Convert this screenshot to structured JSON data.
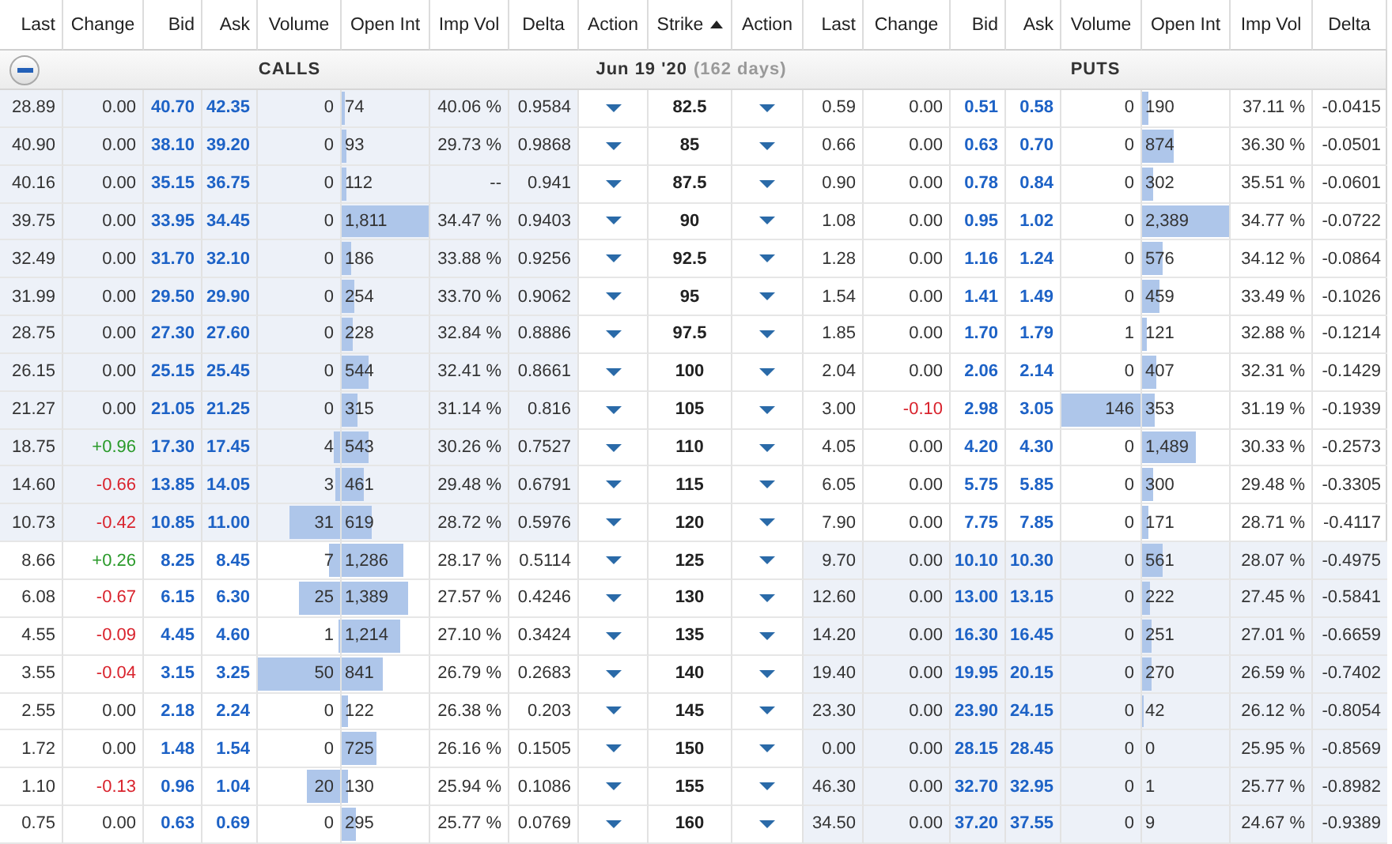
{
  "columns": {
    "calls": [
      "Last",
      "Change",
      "Bid",
      "Ask",
      "Volume",
      "Open Int",
      "Imp Vol",
      "Delta"
    ],
    "left_action": "Action",
    "strike": "Strike",
    "sort_ascending": true,
    "right_action": "Action",
    "puts": [
      "Last",
      "Change",
      "Bid",
      "Ask",
      "Volume",
      "Open Int",
      "Imp Vol",
      "Delta"
    ]
  },
  "section": {
    "expanded": true,
    "calls_label": "CALLS",
    "expiry": "Jun 19 '20",
    "days": "(162 days)",
    "puts_label": "PUTS"
  },
  "rows": [
    {
      "strike": "82.5",
      "call": {
        "last": "28.89",
        "change": {
          "value": "0.00",
          "color": "#333333"
        },
        "bid": "40.70",
        "ask": "42.35",
        "volume": {
          "value": "0",
          "level": 0
        },
        "open_int": {
          "value": "74",
          "level": 0.041
        },
        "imp_vol": "40.06 %",
        "delta": "0.9584",
        "in_the_money": true
      },
      "put": {
        "last": "0.59",
        "change": {
          "value": "0.00",
          "color": "#333333"
        },
        "bid": "0.51",
        "ask": "0.58",
        "volume": {
          "value": "0",
          "level": 0
        },
        "open_int": {
          "value": "190",
          "level": 0.08
        },
        "imp_vol": "37.11 %",
        "delta": "-0.0415",
        "in_the_money": false
      }
    },
    {
      "strike": "85",
      "call": {
        "last": "40.90",
        "change": {
          "value": "0.00",
          "color": "#333333"
        },
        "bid": "38.10",
        "ask": "39.20",
        "volume": {
          "value": "0",
          "level": 0
        },
        "open_int": {
          "value": "93",
          "level": 0.051
        },
        "imp_vol": "29.73 %",
        "delta": "0.9868",
        "in_the_money": true
      },
      "put": {
        "last": "0.66",
        "change": {
          "value": "0.00",
          "color": "#333333"
        },
        "bid": "0.63",
        "ask": "0.70",
        "volume": {
          "value": "0",
          "level": 0
        },
        "open_int": {
          "value": "874",
          "level": 0.366
        },
        "imp_vol": "36.30 %",
        "delta": "-0.0501",
        "in_the_money": false
      }
    },
    {
      "strike": "87.5",
      "call": {
        "last": "40.16",
        "change": {
          "value": "0.00",
          "color": "#333333"
        },
        "bid": "35.15",
        "ask": "36.75",
        "volume": {
          "value": "0",
          "level": 0
        },
        "open_int": {
          "value": "112",
          "level": 0.062
        },
        "imp_vol": "--",
        "delta": "0.941",
        "in_the_money": true
      },
      "put": {
        "last": "0.90",
        "change": {
          "value": "0.00",
          "color": "#333333"
        },
        "bid": "0.78",
        "ask": "0.84",
        "volume": {
          "value": "0",
          "level": 0
        },
        "open_int": {
          "value": "302",
          "level": 0.126
        },
        "imp_vol": "35.51 %",
        "delta": "-0.0601",
        "in_the_money": false
      }
    },
    {
      "strike": "90",
      "call": {
        "last": "39.75",
        "change": {
          "value": "0.00",
          "color": "#333333"
        },
        "bid": "33.95",
        "ask": "34.45",
        "volume": {
          "value": "0",
          "level": 0
        },
        "open_int": {
          "value": "1,811",
          "level": 1
        },
        "imp_vol": "34.47 %",
        "delta": "0.9403",
        "in_the_money": true
      },
      "put": {
        "last": "1.08",
        "change": {
          "value": "0.00",
          "color": "#333333"
        },
        "bid": "0.95",
        "ask": "1.02",
        "volume": {
          "value": "0",
          "level": 0
        },
        "open_int": {
          "value": "2,389",
          "level": 1
        },
        "imp_vol": "34.77 %",
        "delta": "-0.0722",
        "in_the_money": false
      }
    },
    {
      "strike": "92.5",
      "call": {
        "last": "32.49",
        "change": {
          "value": "0.00",
          "color": "#333333"
        },
        "bid": "31.70",
        "ask": "32.10",
        "volume": {
          "value": "0",
          "level": 0
        },
        "open_int": {
          "value": "186",
          "level": 0.103
        },
        "imp_vol": "33.88 %",
        "delta": "0.9256",
        "in_the_money": true
      },
      "put": {
        "last": "1.28",
        "change": {
          "value": "0.00",
          "color": "#333333"
        },
        "bid": "1.16",
        "ask": "1.24",
        "volume": {
          "value": "0",
          "level": 0
        },
        "open_int": {
          "value": "576",
          "level": 0.241
        },
        "imp_vol": "34.12 %",
        "delta": "-0.0864",
        "in_the_money": false
      }
    },
    {
      "strike": "95",
      "call": {
        "last": "31.99",
        "change": {
          "value": "0.00",
          "color": "#333333"
        },
        "bid": "29.50",
        "ask": "29.90",
        "volume": {
          "value": "0",
          "level": 0
        },
        "open_int": {
          "value": "254",
          "level": 0.14
        },
        "imp_vol": "33.70 %",
        "delta": "0.9062",
        "in_the_money": true
      },
      "put": {
        "last": "1.54",
        "change": {
          "value": "0.00",
          "color": "#333333"
        },
        "bid": "1.41",
        "ask": "1.49",
        "volume": {
          "value": "0",
          "level": 0
        },
        "open_int": {
          "value": "459",
          "level": 0.192
        },
        "imp_vol": "33.49 %",
        "delta": "-0.1026",
        "in_the_money": false
      }
    },
    {
      "strike": "97.5",
      "call": {
        "last": "28.75",
        "change": {
          "value": "0.00",
          "color": "#333333"
        },
        "bid": "27.30",
        "ask": "27.60",
        "volume": {
          "value": "0",
          "level": 0
        },
        "open_int": {
          "value": "228",
          "level": 0.126
        },
        "imp_vol": "32.84 %",
        "delta": "0.8886",
        "in_the_money": true
      },
      "put": {
        "last": "1.85",
        "change": {
          "value": "0.00",
          "color": "#333333"
        },
        "bid": "1.70",
        "ask": "1.79",
        "volume": {
          "value": "1",
          "level": 0
        },
        "open_int": {
          "value": "121",
          "level": 0.051
        },
        "imp_vol": "32.88 %",
        "delta": "-0.1214",
        "in_the_money": false
      }
    },
    {
      "strike": "100",
      "call": {
        "last": "26.15",
        "change": {
          "value": "0.00",
          "color": "#333333"
        },
        "bid": "25.15",
        "ask": "25.45",
        "volume": {
          "value": "0",
          "level": 0
        },
        "open_int": {
          "value": "544",
          "level": 0.3
        },
        "imp_vol": "32.41 %",
        "delta": "0.8661",
        "in_the_money": true
      },
      "put": {
        "last": "2.04",
        "change": {
          "value": "0.00",
          "color": "#333333"
        },
        "bid": "2.06",
        "ask": "2.14",
        "volume": {
          "value": "0",
          "level": 0
        },
        "open_int": {
          "value": "407",
          "level": 0.17
        },
        "imp_vol": "32.31 %",
        "delta": "-0.1429",
        "in_the_money": false
      }
    },
    {
      "strike": "105",
      "call": {
        "last": "21.27",
        "change": {
          "value": "0.00",
          "color": "#333333"
        },
        "bid": "21.05",
        "ask": "21.25",
        "volume": {
          "value": "0",
          "level": 0
        },
        "open_int": {
          "value": "315",
          "level": 0.174
        },
        "imp_vol": "31.14 %",
        "delta": "0.816",
        "in_the_money": true
      },
      "put": {
        "last": "3.00",
        "change": {
          "value": "-0.10",
          "color": "#d9232d"
        },
        "bid": "2.98",
        "ask": "3.05",
        "volume": {
          "value": "146",
          "level": 1
        },
        "open_int": {
          "value": "353",
          "level": 0.148
        },
        "imp_vol": "31.19 %",
        "delta": "-0.1939",
        "in_the_money": false
      }
    },
    {
      "strike": "110",
      "call": {
        "last": "18.75",
        "change": {
          "value": "+0.96",
          "color": "#2a9a2a"
        },
        "bid": "17.30",
        "ask": "17.45",
        "volume": {
          "value": "4",
          "level": 0.08
        },
        "open_int": {
          "value": "543",
          "level": 0.3
        },
        "imp_vol": "30.26 %",
        "delta": "0.7527",
        "in_the_money": true
      },
      "put": {
        "last": "4.05",
        "change": {
          "value": "0.00",
          "color": "#333333"
        },
        "bid": "4.20",
        "ask": "4.30",
        "volume": {
          "value": "0",
          "level": 0
        },
        "open_int": {
          "value": "1,489",
          "level": 0.623
        },
        "imp_vol": "30.33 %",
        "delta": "-0.2573",
        "in_the_money": false
      }
    },
    {
      "strike": "115",
      "call": {
        "last": "14.60",
        "change": {
          "value": "-0.66",
          "color": "#d9232d"
        },
        "bid": "13.85",
        "ask": "14.05",
        "volume": {
          "value": "3",
          "level": 0.06
        },
        "open_int": {
          "value": "461",
          "level": 0.255
        },
        "imp_vol": "29.48 %",
        "delta": "0.6791",
        "in_the_money": true
      },
      "put": {
        "last": "6.05",
        "change": {
          "value": "0.00",
          "color": "#333333"
        },
        "bid": "5.75",
        "ask": "5.85",
        "volume": {
          "value": "0",
          "level": 0
        },
        "open_int": {
          "value": "300",
          "level": 0.126
        },
        "imp_vol": "29.48 %",
        "delta": "-0.3305",
        "in_the_money": false
      }
    },
    {
      "strike": "120",
      "call": {
        "last": "10.73",
        "change": {
          "value": "-0.42",
          "color": "#d9232d"
        },
        "bid": "10.85",
        "ask": "11.00",
        "volume": {
          "value": "31",
          "level": 0.62
        },
        "open_int": {
          "value": "619",
          "level": 0.342
        },
        "imp_vol": "28.72 %",
        "delta": "0.5976",
        "in_the_money": true
      },
      "put": {
        "last": "7.90",
        "change": {
          "value": "0.00",
          "color": "#333333"
        },
        "bid": "7.75",
        "ask": "7.85",
        "volume": {
          "value": "0",
          "level": 0
        },
        "open_int": {
          "value": "171",
          "level": 0.072
        },
        "imp_vol": "28.71 %",
        "delta": "-0.4117",
        "in_the_money": false
      }
    },
    {
      "strike": "125",
      "call": {
        "last": "8.66",
        "change": {
          "value": "+0.26",
          "color": "#2a9a2a"
        },
        "bid": "8.25",
        "ask": "8.45",
        "volume": {
          "value": "7",
          "level": 0.14
        },
        "open_int": {
          "value": "1,286",
          "level": 0.71
        },
        "imp_vol": "28.17 %",
        "delta": "0.5114",
        "in_the_money": false
      },
      "put": {
        "last": "9.70",
        "change": {
          "value": "0.00",
          "color": "#333333"
        },
        "bid": "10.10",
        "ask": "10.30",
        "volume": {
          "value": "0",
          "level": 0
        },
        "open_int": {
          "value": "561",
          "level": 0.235
        },
        "imp_vol": "28.07 %",
        "delta": "-0.4975",
        "in_the_money": true
      }
    },
    {
      "strike": "130",
      "call": {
        "last": "6.08",
        "change": {
          "value": "-0.67",
          "color": "#d9232d"
        },
        "bid": "6.15",
        "ask": "6.30",
        "volume": {
          "value": "25",
          "level": 0.5
        },
        "open_int": {
          "value": "1,389",
          "level": 0.767
        },
        "imp_vol": "27.57 %",
        "delta": "0.4246",
        "in_the_money": false
      },
      "put": {
        "last": "12.60",
        "change": {
          "value": "0.00",
          "color": "#333333"
        },
        "bid": "13.00",
        "ask": "13.15",
        "volume": {
          "value": "0",
          "level": 0
        },
        "open_int": {
          "value": "222",
          "level": 0.093
        },
        "imp_vol": "27.45 %",
        "delta": "-0.5841",
        "in_the_money": true
      }
    },
    {
      "strike": "135",
      "call": {
        "last": "4.55",
        "change": {
          "value": "-0.09",
          "color": "#d9232d"
        },
        "bid": "4.45",
        "ask": "4.60",
        "volume": {
          "value": "1",
          "level": 0.02
        },
        "open_int": {
          "value": "1,214",
          "level": 0.67
        },
        "imp_vol": "27.10 %",
        "delta": "0.3424",
        "in_the_money": false
      },
      "put": {
        "last": "14.20",
        "change": {
          "value": "0.00",
          "color": "#333333"
        },
        "bid": "16.30",
        "ask": "16.45",
        "volume": {
          "value": "0",
          "level": 0
        },
        "open_int": {
          "value": "251",
          "level": 0.105
        },
        "imp_vol": "27.01 %",
        "delta": "-0.6659",
        "in_the_money": true
      }
    },
    {
      "strike": "140",
      "call": {
        "last": "3.55",
        "change": {
          "value": "-0.04",
          "color": "#d9232d"
        },
        "bid": "3.15",
        "ask": "3.25",
        "volume": {
          "value": "50",
          "level": 1
        },
        "open_int": {
          "value": "841",
          "level": 0.464
        },
        "imp_vol": "26.79 %",
        "delta": "0.2683",
        "in_the_money": false
      },
      "put": {
        "last": "19.40",
        "change": {
          "value": "0.00",
          "color": "#333333"
        },
        "bid": "19.95",
        "ask": "20.15",
        "volume": {
          "value": "0",
          "level": 0
        },
        "open_int": {
          "value": "270",
          "level": 0.113
        },
        "imp_vol": "26.59 %",
        "delta": "-0.7402",
        "in_the_money": true
      }
    },
    {
      "strike": "145",
      "call": {
        "last": "2.55",
        "change": {
          "value": "0.00",
          "color": "#333333"
        },
        "bid": "2.18",
        "ask": "2.24",
        "volume": {
          "value": "0",
          "level": 0
        },
        "open_int": {
          "value": "122",
          "level": 0.067
        },
        "imp_vol": "26.38 %",
        "delta": "0.203",
        "in_the_money": false
      },
      "put": {
        "last": "23.30",
        "change": {
          "value": "0.00",
          "color": "#333333"
        },
        "bid": "23.90",
        "ask": "24.15",
        "volume": {
          "value": "0",
          "level": 0
        },
        "open_int": {
          "value": "42",
          "level": 0.018
        },
        "imp_vol": "26.12 %",
        "delta": "-0.8054",
        "in_the_money": true
      }
    },
    {
      "strike": "150",
      "call": {
        "last": "1.72",
        "change": {
          "value": "0.00",
          "color": "#333333"
        },
        "bid": "1.48",
        "ask": "1.54",
        "volume": {
          "value": "0",
          "level": 0
        },
        "open_int": {
          "value": "725",
          "level": 0.4
        },
        "imp_vol": "26.16 %",
        "delta": "0.1505",
        "in_the_money": false
      },
      "put": {
        "last": "0.00",
        "change": {
          "value": "0.00",
          "color": "#333333"
        },
        "bid": "28.15",
        "ask": "28.45",
        "volume": {
          "value": "0",
          "level": 0
        },
        "open_int": {
          "value": "0",
          "level": 0
        },
        "imp_vol": "25.95 %",
        "delta": "-0.8569",
        "in_the_money": true
      }
    },
    {
      "strike": "155",
      "call": {
        "last": "1.10",
        "change": {
          "value": "-0.13",
          "color": "#d9232d"
        },
        "bid": "0.96",
        "ask": "1.04",
        "volume": {
          "value": "20",
          "level": 0.4
        },
        "open_int": {
          "value": "130",
          "level": 0.072
        },
        "imp_vol": "25.94 %",
        "delta": "0.1086",
        "in_the_money": false
      },
      "put": {
        "last": "46.30",
        "change": {
          "value": "0.00",
          "color": "#333333"
        },
        "bid": "32.70",
        "ask": "32.95",
        "volume": {
          "value": "0",
          "level": 0
        },
        "open_int": {
          "value": "1",
          "level": 0
        },
        "imp_vol": "25.77 %",
        "delta": "-0.8982",
        "in_the_money": true
      }
    },
    {
      "strike": "160",
      "call": {
        "last": "0.75",
        "change": {
          "value": "0.00",
          "color": "#333333"
        },
        "bid": "0.63",
        "ask": "0.69",
        "volume": {
          "value": "0",
          "level": 0
        },
        "open_int": {
          "value": "295",
          "level": 0.163
        },
        "imp_vol": "25.77 %",
        "delta": "0.0769",
        "in_the_money": false
      },
      "put": {
        "last": "34.50",
        "change": {
          "value": "0.00",
          "color": "#333333"
        },
        "bid": "37.20",
        "ask": "37.55",
        "volume": {
          "value": "0",
          "level": 0
        },
        "open_int": {
          "value": "9",
          "level": 0
        },
        "imp_vol": "24.67 %",
        "delta": "-0.9389",
        "in_the_money": true
      }
    }
  ]
}
